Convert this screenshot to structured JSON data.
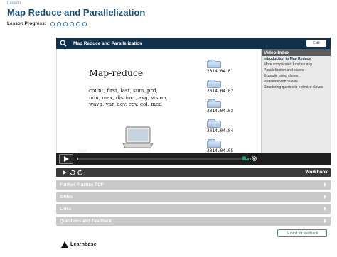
{
  "breadcrumb": "Lesson",
  "title": "Map Reduce and Parallelization",
  "progress": {
    "label": "Lesson Progress:",
    "total": 6,
    "completed": 0
  },
  "player": {
    "title": "Map Reduce and Parallelization",
    "edit_label": "Edit",
    "timestamp": "00:02",
    "played_fraction": 0.004
  },
  "slide": {
    "heading": "Map-reduce",
    "lines": [
      "count, first, last, sum, prd,",
      "min, max, distinct, avg, wsum,",
      "wavg, var, dev, cov, col, med"
    ],
    "dates": [
      "2014.04.01",
      "2014.04.02",
      "2014.04.03",
      "2014.04.04",
      "2014.04.05"
    ]
  },
  "video_index": {
    "header": "Video Index",
    "items": [
      "Introduction to Map Reduce",
      "More complicated function avg",
      "Parallelization and slaves",
      "Example using slaves",
      "Problems with Slaves",
      "Structuring queries to optimize slaves"
    ],
    "active_index": 0
  },
  "toolbar": {
    "workbook_label": "Workbook"
  },
  "sections": [
    "Further Practice PDF",
    "Slides",
    "Links",
    "Questions and Feedback"
  ],
  "feedback_label": "Submit for feedback",
  "brand": "Learnbase",
  "colors": {
    "header": "#11304a",
    "title": "#1a4f7a",
    "accent": "#1aa67a",
    "accordion": "#c9c9c9"
  }
}
